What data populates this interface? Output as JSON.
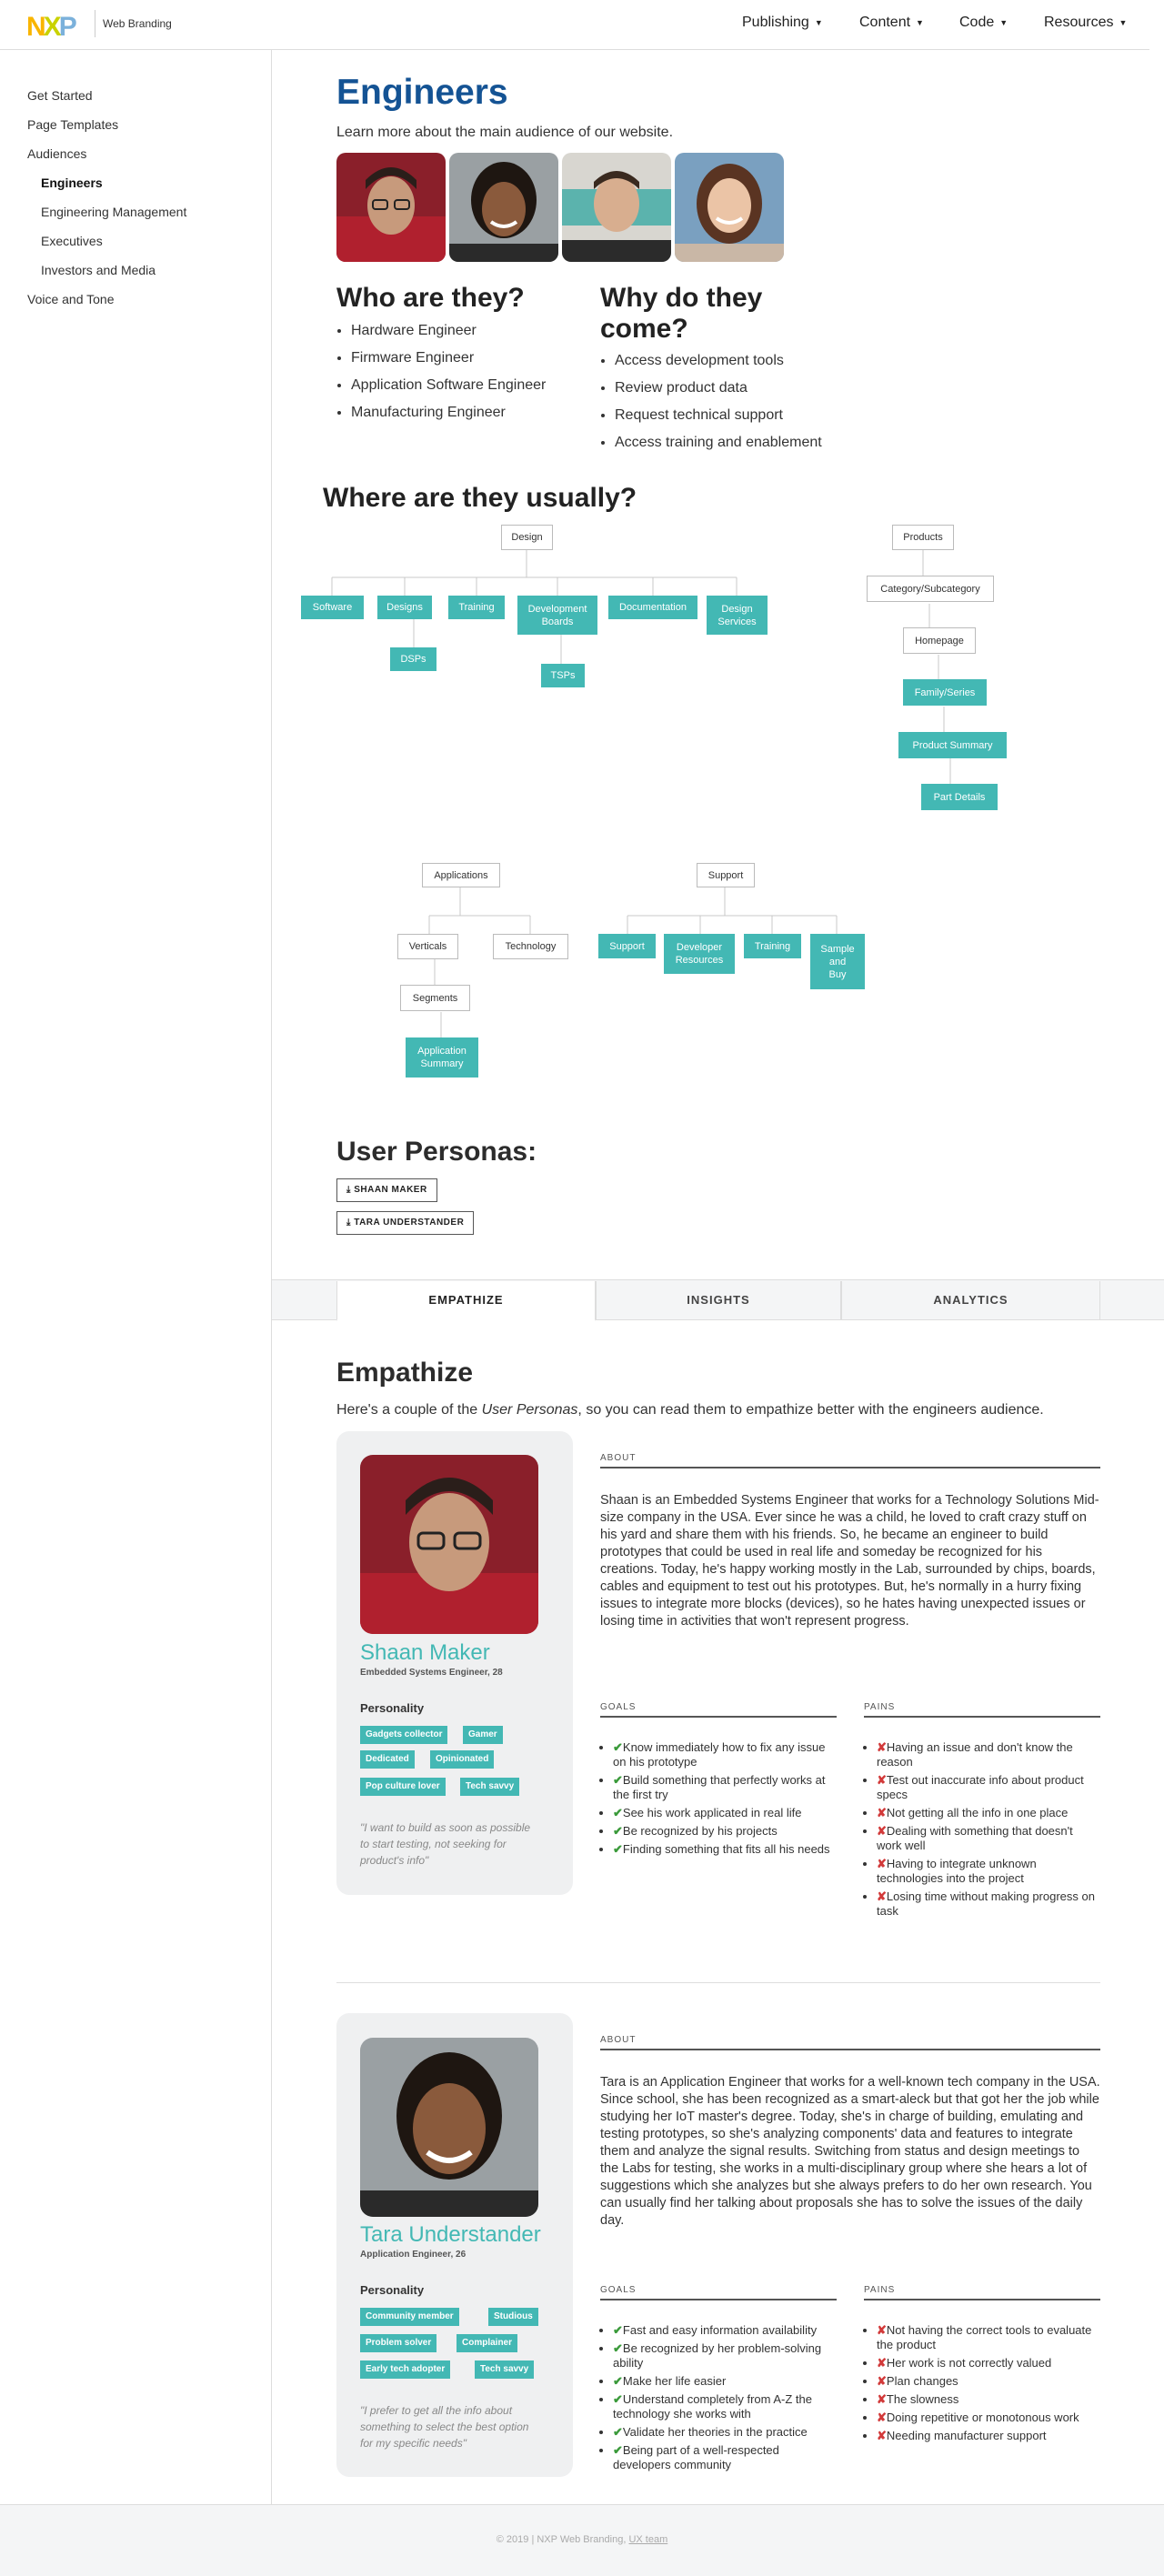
{
  "header": {
    "brand": "Web Branding",
    "nav": [
      "Publishing",
      "Content",
      "Code",
      "Resources"
    ]
  },
  "sidebar": {
    "items": [
      {
        "label": "Get Started"
      },
      {
        "label": "Page Templates"
      },
      {
        "label": "Audiences"
      },
      {
        "label": "Engineers"
      },
      {
        "label": "Engineering Management"
      },
      {
        "label": "Executives"
      },
      {
        "label": "Investors and Media"
      },
      {
        "label": "Voice and Tone"
      }
    ]
  },
  "main": {
    "title": "Engineers",
    "lead": "Learn more about the main audience of our website.",
    "who": {
      "title": "Who are they?",
      "items": [
        "Hardware Engineer",
        "Firmware Engineer",
        "Application Software Engineer",
        "Manufacturing Engineer"
      ]
    },
    "why": {
      "title": "Why do they come?",
      "items": [
        "Access development tools",
        "Review product data",
        "Request technical support",
        "Access training and enablement"
      ]
    },
    "where": {
      "title": "Where are they usually?",
      "nodes": {
        "design": "Design",
        "software": "Software",
        "designs": "Designs",
        "training": "Training",
        "dev_boards": "Development Boards",
        "documentation": "Documentation",
        "design_services": "Design Services",
        "dsps": "DSPs",
        "tsps": "TSPs",
        "products": "Products",
        "category": "Category/Subcategory",
        "homepage": "Homepage",
        "family": "Family/Series",
        "product_summary": "Product Summary",
        "part_details": "Part Details",
        "applications": "Applications",
        "verticals": "Verticals",
        "technology": "Technology",
        "segments": "Segments",
        "app_summary": "Application Summary",
        "support": "Support",
        "support2": "Support",
        "dev_resources": "Developer Resources",
        "training2": "Training",
        "sample_buy": "Sample and Buy"
      }
    },
    "personas": {
      "title": "User Personas:",
      "downloads": [
        "SHAAN MAKER",
        "TARA UNDERSTANDER"
      ]
    },
    "tabs": [
      "EMPATHIZE",
      "INSIGHTS",
      "ANALYTICS"
    ],
    "empathize": {
      "title": "Empathize",
      "lead_pre": "Here's a couple of the ",
      "lead_em": "User Personas",
      "lead_post": ", so you can read them to empathize better with the engineers audience.",
      "about_label": "ABOUT",
      "goals_label": "GOALS",
      "pains_label": "PAINS",
      "personality_label": "Personality",
      "persons": [
        {
          "name": "Shaan Maker",
          "role": "Embedded Systems Engineer, 28",
          "tags": [
            "Gadgets collector",
            "Gamer",
            "Dedicated",
            "Opinionated",
            "Pop culture lover",
            "Tech savvy"
          ],
          "quote": "\"I want to build as soon as possible to start testing, not seeking for product's info\"",
          "about": "Shaan is an Embedded Systems Engineer that works for a Technology Solutions Mid-size company in the USA. Ever since he was a child, he loved to craft crazy stuff on his yard and share them with his friends. So, he became an engineer to build prototypes that could be used in real life and someday be recognized for his creations. Today, he's happy working mostly in the Lab, surrounded by chips, boards, cables and equipment to test out his prototypes. But, he's normally in a hurry fixing issues to integrate more blocks (devices), so he hates having unexpected issues or losing time in activities that won't represent progress.",
          "goals": [
            "Know immediately how to fix any issue on his prototype",
            "Build something that perfectly works at the first try",
            "See his work applicated in real life",
            "Be recognized by his projects",
            "Finding something that fits all his needs"
          ],
          "pains": [
            "Having an issue and don't know the reason",
            "Test out inaccurate info about product specs",
            "Not getting all the info in one place",
            "Dealing with something that doesn't work well",
            "Having to integrate unknown technologies into the project",
            "Losing time without making progress on task"
          ]
        },
        {
          "name": "Tara Understander",
          "role": "Application Engineer, 26",
          "tags": [
            "Community member",
            "Studious",
            "Problem solver",
            "Complainer",
            "Early tech adopter",
            "Tech savvy"
          ],
          "quote": "\"I prefer to get all the info about something to select the best option for my specific needs\"",
          "about": "Tara is an Application Engineer that works for a well-known tech company in the USA. Since school, she has been recognized as a smart-aleck but that got her the job while studying her IoT master's degree. Today, she's in charge of building, emulating and testing prototypes, so she's analyzing components' data and features to integrate them and analyze the signal results. Switching from status and design meetings to the Labs for testing, she works in a multi-disciplinary group where she hears a lot of suggestions which she analyzes but she always prefers to do her own research. You can usually find her talking about proposals she has to solve the issues of the daily day.",
          "goals": [
            "Fast and easy information availability",
            "Be recognized by her problem-solving ability",
            "Make her life easier",
            "Understand completely from A-Z the technology she works with",
            "Validate her theories in the practice",
            "Being part of a well-respected developers community"
          ],
          "pains": [
            "Not having the correct tools to evaluate the product",
            "Her work is not correctly valued",
            "Plan changes",
            "The slowness",
            "Doing repetitive or monotonous work",
            "Needing manufacturer support"
          ]
        }
      ]
    }
  },
  "footer": {
    "text": "© 2019 | NXP Web Branding,",
    "link": "UX team"
  },
  "colors": {
    "title_blue": "#145394",
    "teal": "#43b8b4",
    "logo_n": "#f9b500",
    "logo_x": "#c9d200",
    "logo_p": "#7bb1db"
  }
}
